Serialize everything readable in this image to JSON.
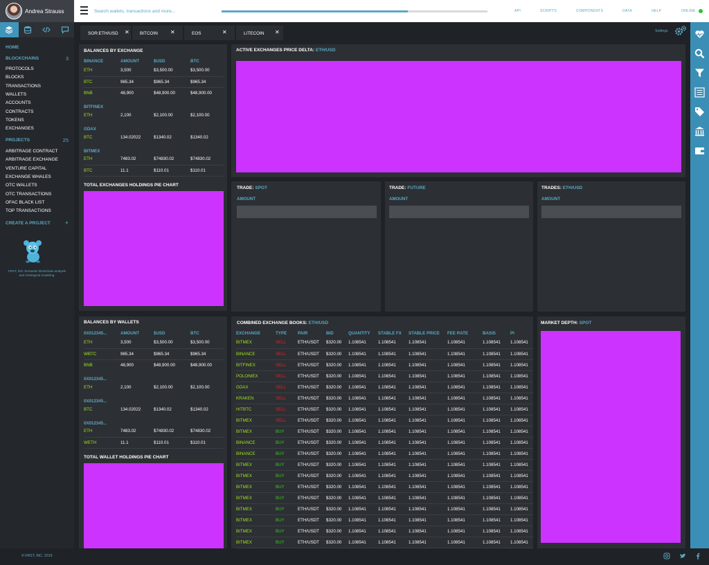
{
  "user": {
    "name": "Andrea Strauss"
  },
  "search": {
    "placeholder": "Search wallets, transactions and more..."
  },
  "progress": {
    "value": 0.7
  },
  "topnav": [
    "API",
    "SCRIPTS",
    "COMPONENTS",
    "DATA",
    "HELP",
    "ONLINE"
  ],
  "status_color": "#2ec42e",
  "accent": "#5aa8c4",
  "placeholder_color": "#cc33ff",
  "iconbar": [
    "layers-icon",
    "database-icon",
    "code-icon",
    "chat-icon"
  ],
  "sidebar": {
    "home": "HOME",
    "blockchains": {
      "label": "BLOCKCHAINS",
      "count": "3",
      "items": [
        "PROTOCOLS",
        "BLOCKS",
        "TRANSACTIONS",
        "WALLETS",
        "ACCOUNTS",
        "CONTRACTS",
        "TOKENS",
        "EXCHANGES"
      ]
    },
    "projects": {
      "label": "PROJECTS",
      "count": "25",
      "items": [
        "ARBITRAGE CONTRACT",
        "ARBITRAGE EXCHANGE",
        "VENTURE CAPITAL",
        "EXCHANGE WHALES",
        "OTC WALLETS",
        "OTC TRANSACTIONS",
        "OFAC BLACK LIST",
        "TOP TRANSACTIONS"
      ]
    },
    "create": "CREATE A PROJECT",
    "create_icon": "+",
    "caption": "FRST, INC Semantic blockchain analysis and ontological modeling."
  },
  "tabs": [
    {
      "label": "SOR:ETH/USD"
    },
    {
      "label": "BITCOIN"
    },
    {
      "label": "EOS"
    },
    {
      "label": "LITECOIN"
    }
  ],
  "tab_close": "✕",
  "settings": {
    "label": "Settings"
  },
  "balances_exchange": {
    "title": "BALANCES BY EXCHANGE",
    "columns": [
      "BINANCE",
      "AMOUNT",
      "$USD",
      "BTC"
    ],
    "rows": [
      {
        "type": "row",
        "cells": [
          "ETH",
          "3,500",
          "$3,500.00",
          "$3,500.00"
        ]
      },
      {
        "type": "row",
        "cells": [
          "BTC",
          "965.34",
          "$965.34",
          "$965.34"
        ]
      },
      {
        "type": "row",
        "cells": [
          "BNB",
          "48,900",
          "$48,900.00",
          "$48,900.00"
        ]
      },
      {
        "type": "group",
        "label": "BITFINEX"
      },
      {
        "type": "row",
        "cells": [
          "ETH",
          "2,100",
          "$2,100.00",
          "$2,100.00"
        ]
      },
      {
        "type": "group",
        "label": "GDAX"
      },
      {
        "type": "row",
        "cells": [
          "BTC",
          "134.02022",
          "$1340.02",
          "$1340.02"
        ]
      },
      {
        "type": "group",
        "label": "BITMEX"
      },
      {
        "type": "row",
        "cells": [
          "ETH",
          "7483.02",
          "$74830.02",
          "$74830.02"
        ]
      },
      {
        "type": "row",
        "cells": [
          "BTC",
          "11.1",
          "$110.01",
          "$110.01"
        ]
      }
    ]
  },
  "pie_exchange": {
    "title": "TOTAL EXCHANGES HOLDINGS PIE CHART"
  },
  "delta": {
    "title": "ACTIVE EXCHANGES PRICE DELTA:",
    "pair": "ETH/USD"
  },
  "trade_spot": {
    "title": "TRADE:",
    "pair": "SPOT",
    "field": "AMOUNT"
  },
  "trade_future": {
    "title": "TRADE:",
    "pair": "FUTURE",
    "field": "AMOUNT"
  },
  "trades_eth": {
    "title": "TRADES:",
    "pair": "ETH/USD",
    "field": "AMOUNT"
  },
  "balances_wallets": {
    "title": "BALANCES BY WALLETS",
    "columns": [
      "0X012345...",
      "AMOUNT",
      "$USD",
      "BTC"
    ],
    "rows": [
      {
        "type": "row",
        "cells": [
          "ETH",
          "3,500",
          "$3,500.00",
          "$3,500.00"
        ]
      },
      {
        "type": "row",
        "cells": [
          "WBTC",
          "965.34",
          "$965.34",
          "$965.34"
        ]
      },
      {
        "type": "row",
        "cells": [
          "BNB",
          "48,900",
          "$48,900.00",
          "$48,900.00"
        ]
      },
      {
        "type": "group",
        "label": "0X012345..."
      },
      {
        "type": "row",
        "cells": [
          "ETH",
          "2,100",
          "$2,100.00",
          "$2,100.00"
        ]
      },
      {
        "type": "group",
        "label": "0X012345..."
      },
      {
        "type": "row",
        "cells": [
          "BTC",
          "134.02022",
          "$1340.02",
          "$1340.02"
        ]
      },
      {
        "type": "group",
        "label": "0X012345..."
      },
      {
        "type": "row",
        "cells": [
          "ETH",
          "7483.02",
          "$74830.02",
          "$74830.02"
        ]
      },
      {
        "type": "row",
        "cells": [
          "WETH",
          "11.1",
          "$110.01",
          "$110.01"
        ]
      }
    ]
  },
  "pie_wallet": {
    "title": "TOTAL WALLET HOLDINGS PIE CHART"
  },
  "books": {
    "title": "COMBINED EXCHANGE BOOKS:",
    "pair": "ETH/USD",
    "columns": [
      "EXCHANGE",
      "TYPE",
      "PAIR",
      "BID",
      "QUANTITY",
      "STABLE FX",
      "STABLE PRICE",
      "FEE RATE",
      "BASIS",
      "PI"
    ],
    "rows": [
      [
        "BITMEX",
        "SELL",
        "ETH/USDT",
        "$320.00",
        "1.108541",
        "1.108541",
        "1.108541",
        "1.108541",
        "1.108541",
        "1.108541"
      ],
      [
        "BINANCE",
        "SELL",
        "ETH/USDT",
        "$320.00",
        "1.108541",
        "1.108541",
        "1.108541",
        "1.108541",
        "1.108541",
        "1.108541"
      ],
      [
        "BITFINEX",
        "SELL",
        "ETH/USDT",
        "$320.00",
        "1.108541",
        "1.108541",
        "1.108541",
        "1.108541",
        "1.108541",
        "1.108541"
      ],
      [
        "POLONIEX",
        "SELL",
        "ETH/USDT",
        "$320.00",
        "1.108541",
        "1.108541",
        "1.108541",
        "1.108541",
        "1.108541",
        "1.108541"
      ],
      [
        "GDAX",
        "SELL",
        "ETH/USDT",
        "$320.00",
        "1.108541",
        "1.108541",
        "1.108541",
        "1.108541",
        "1.108541",
        "1.108541"
      ],
      [
        "KRAKEN",
        "SELL",
        "ETH/USDT",
        "$320.00",
        "1.108541",
        "1.108541",
        "1.108541",
        "1.108541",
        "1.108541",
        "1.108541"
      ],
      [
        "HITBTC",
        "SELL",
        "ETH/USDT",
        "$320.00",
        "1.108541",
        "1.108541",
        "1.108541",
        "1.108541",
        "1.108541",
        "1.108541"
      ],
      [
        "BITMEX",
        "SELL",
        "ETH/USDT",
        "$320.00",
        "1.108541",
        "1.108541",
        "1.108541",
        "1.108541",
        "1.108541",
        "1.108541"
      ],
      [
        "BITMEX",
        "BUY",
        "ETH/USDT",
        "$320.00",
        "1.108541",
        "1.108541",
        "1.108541",
        "1.108541",
        "1.108541",
        "1.108541"
      ],
      [
        "BINANCE",
        "BUY",
        "ETH/USDT",
        "$320.00",
        "1.108541",
        "1.108541",
        "1.108541",
        "1.108541",
        "1.108541",
        "1.108541"
      ],
      [
        "BINANCE",
        "BUY",
        "ETH/USDT",
        "$320.00",
        "1.108541",
        "1.108541",
        "1.108541",
        "1.108541",
        "1.108541",
        "1.108541"
      ],
      [
        "BITMEX",
        "BUY",
        "ETH/USDT",
        "$320.00",
        "1.108541",
        "1.108541",
        "1.108541",
        "1.108541",
        "1.108541",
        "1.108541"
      ],
      [
        "BITMEX",
        "BUY",
        "ETH/USDT",
        "$320.00",
        "1.108541",
        "1.108541",
        "1.108541",
        "1.108541",
        "1.108541",
        "1.108541"
      ],
      [
        "BITMEX",
        "BUY",
        "ETH/USDT",
        "$320.00",
        "1.108541",
        "1.108541",
        "1.108541",
        "1.108541",
        "1.108541",
        "1.108541"
      ],
      [
        "BITMEX",
        "BUY",
        "ETH/USDT",
        "$320.00",
        "1.108541",
        "1.108541",
        "1.108541",
        "1.108541",
        "1.108541",
        "1.108541"
      ],
      [
        "BITMEX",
        "BUY",
        "ETH/USDT",
        "$320.00",
        "1.108541",
        "1.108541",
        "1.108541",
        "1.108541",
        "1.108541",
        "1.108541"
      ],
      [
        "BITMEX",
        "BUY",
        "ETH/USDT",
        "$320.00",
        "1.108541",
        "1.108541",
        "1.108541",
        "1.108541",
        "1.108541",
        "1.108541"
      ],
      [
        "BITMEX",
        "BUY",
        "ETH/USDT",
        "$320.00",
        "1.108541",
        "1.108541",
        "1.108541",
        "1.108541",
        "1.108541",
        "1.108541"
      ],
      [
        "BITMEX",
        "BUY",
        "ETH/USDT",
        "$320.00",
        "1.108541",
        "1.108541",
        "1.108541",
        "1.108541",
        "1.108541",
        "1.108541"
      ]
    ]
  },
  "depth": {
    "title": "MARKET DEPTH:",
    "pair": "SPOT"
  },
  "rightbar": [
    "heart-pulse-icon",
    "search-icon",
    "filter-icon",
    "list-icon",
    "tags-icon",
    "bank-icon",
    "wallet-icon"
  ],
  "footer": {
    "copyright": "© FRST, INC. 2019",
    "social": [
      "instagram-icon",
      "twitter-icon",
      "facebook-icon"
    ]
  }
}
